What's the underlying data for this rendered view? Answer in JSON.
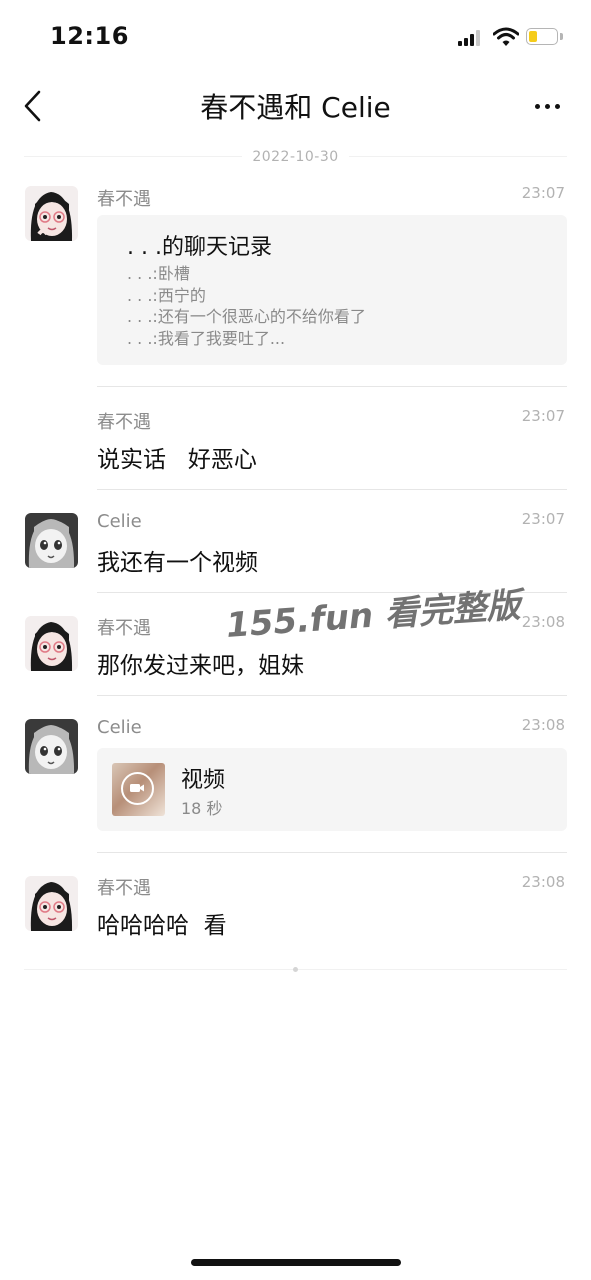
{
  "status_bar": {
    "time": "12:16",
    "battery_level": 0.3
  },
  "nav": {
    "title": "春不遇和 Celie",
    "back_icon": "chevron-left-icon",
    "more_icon": "more-horizontal-icon"
  },
  "date": "2022-10-30",
  "messages": [
    {
      "sender": "春不遇",
      "time": "23:07",
      "type": "chat-record",
      "record_title": ". . .的聊天记录",
      "record_lines": [
        ". . .:卧槽",
        ". . .:西宁的",
        ". . .:还有一个很恶心的不给你看了",
        ". . .:我看了我要吐了..."
      ]
    },
    {
      "sender": "春不遇",
      "time": "23:07",
      "type": "text",
      "text": "说实话   好恶心"
    },
    {
      "sender": "Celie",
      "time": "23:07",
      "type": "text",
      "text": "我还有一个视频"
    },
    {
      "sender": "春不遇",
      "time": "23:08",
      "type": "text",
      "text": "那你发过来吧，姐妹"
    },
    {
      "sender": "Celie",
      "time": "23:08",
      "type": "video",
      "video_title": "视频",
      "duration": "18 秒"
    },
    {
      "sender": "春不遇",
      "time": "23:08",
      "type": "text",
      "text": "哈哈哈哈  看"
    }
  ],
  "watermark": "155.fun 看完整版",
  "colors": {
    "battery": "#f5cc1b",
    "card_bg": "#f5f5f5",
    "meta_text": "#8c8c8c"
  }
}
